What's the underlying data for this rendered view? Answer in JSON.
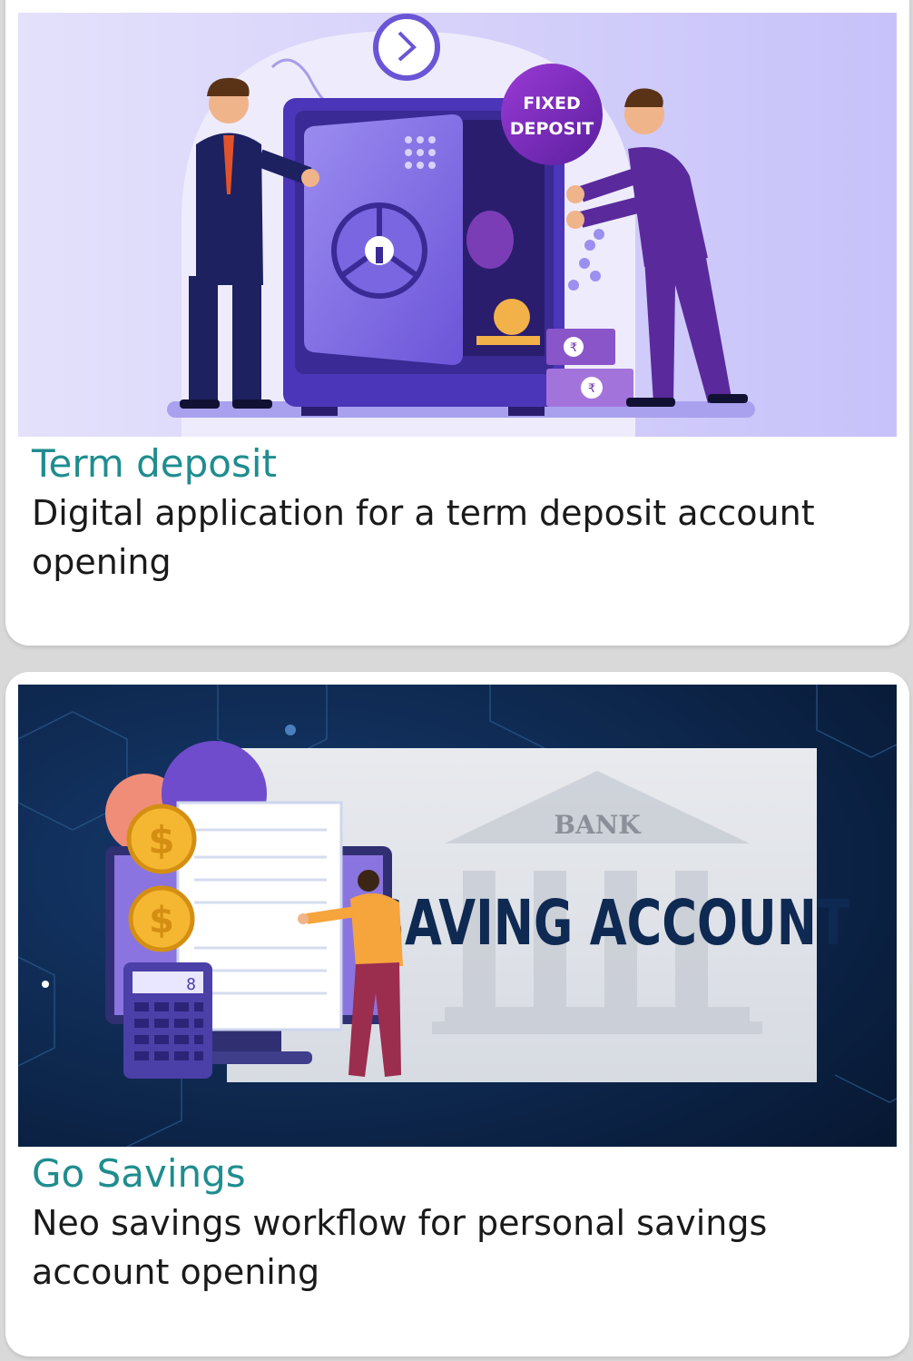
{
  "cards": [
    {
      "title": "Term deposit",
      "description": "Digital application for a term deposit account opening",
      "image": {
        "badge_line1": "FIXED",
        "badge_line2": "DEPOSIT",
        "currency_symbol": "₹",
        "colors": {
          "background": "#ddd8fb",
          "safe": "#5b45c9",
          "accent": "#7a2fbf"
        }
      }
    },
    {
      "title": "Go Savings",
      "description": "Neo savings workflow for personal savings account opening",
      "image": {
        "bank_label": "BANK",
        "headline": "SAVING ACCOUNT",
        "coin_symbol": "$",
        "calculator_display": "8",
        "colors": {
          "background": "#0c2347",
          "headline": "#0f2a52",
          "coin": "#f5b731"
        }
      }
    }
  ],
  "colors": {
    "title": "#1f8d8f",
    "text": "#1a1a1a",
    "page_bg": "#d9d9d9",
    "card_bg": "#ffffff"
  }
}
